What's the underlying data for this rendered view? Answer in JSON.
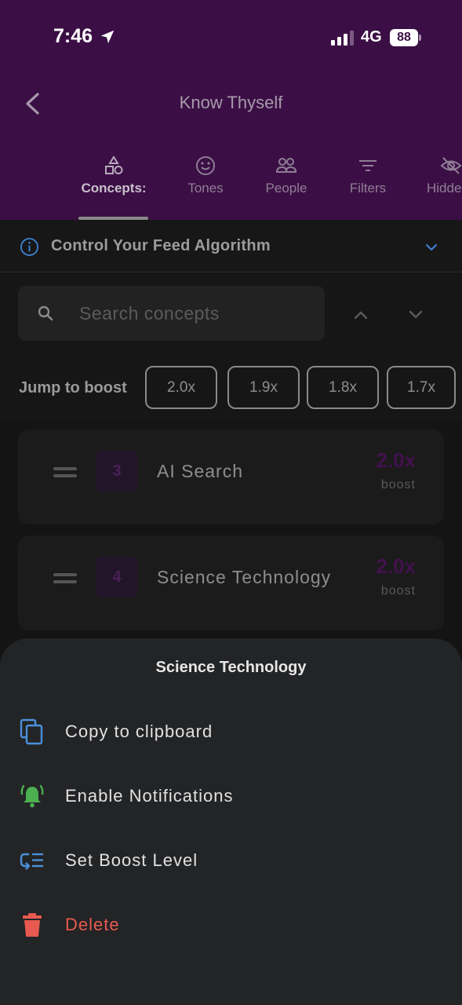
{
  "status_bar": {
    "time": "7:46",
    "network": "4G",
    "battery": "88"
  },
  "header": {
    "title": "Know Thyself"
  },
  "tabs": [
    {
      "label": "Concepts:",
      "icon": "shapes-icon"
    },
    {
      "label": "Tones",
      "icon": "smiley-icon"
    },
    {
      "label": "People",
      "icon": "people-icon"
    },
    {
      "label": "Filters",
      "icon": "filter-icon"
    },
    {
      "label": "Hidde",
      "icon": "eye-off-icon"
    }
  ],
  "info_bar": {
    "text": "Control Your Feed Algorithm"
  },
  "search": {
    "placeholder": "Search concepts"
  },
  "jump": {
    "label": "Jump to boost",
    "chips": [
      "2.0x",
      "1.9x",
      "1.8x",
      "1.7x"
    ]
  },
  "concepts": [
    {
      "rank": "3",
      "name": "AI Search",
      "boost": "2.0x",
      "boost_label": "boost"
    },
    {
      "rank": "4",
      "name": "Science Technology",
      "boost": "2.0x",
      "boost_label": "boost"
    }
  ],
  "sheet": {
    "title": "Science Technology",
    "actions": [
      {
        "label": "Copy to clipboard",
        "icon": "copy-icon",
        "color": "#4a90d9"
      },
      {
        "label": "Enable Notifications",
        "icon": "bell-alert-icon",
        "color": "#4caf50"
      },
      {
        "label": "Set Boost Level",
        "icon": "boost-level-icon",
        "color": "#4a90d9"
      },
      {
        "label": "Delete",
        "icon": "trash-icon",
        "color": "#e85a4f"
      }
    ]
  },
  "colors": {
    "header_bg": "#3b0f45",
    "sheet_bg": "#232426",
    "accent_blue": "#4a90d9",
    "danger": "#e85a4f"
  }
}
